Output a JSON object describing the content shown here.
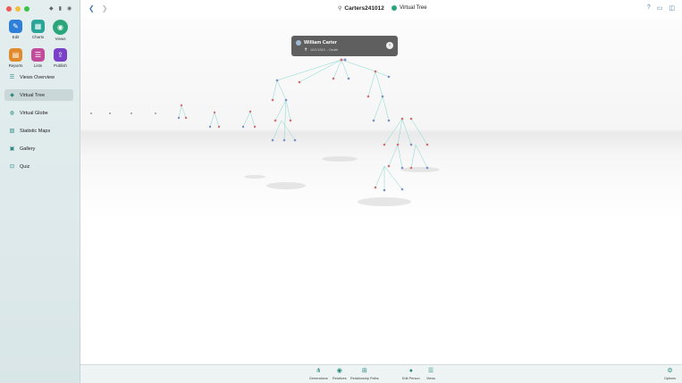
{
  "window": {
    "title": "Carters241012",
    "view_name": "Virtual Tree"
  },
  "sidebar": {
    "apps": [
      {
        "label": "Edit",
        "icon": "pencil-icon",
        "color": "#2f7fd8"
      },
      {
        "label": "Charts",
        "icon": "charts-icon",
        "color": "#2aa699"
      },
      {
        "label": "Views",
        "icon": "eye-icon",
        "color": "#2aa67a",
        "selected": true
      },
      {
        "label": "Reports",
        "icon": "reports-icon",
        "color": "#e08a2c"
      },
      {
        "label": "Lists",
        "icon": "list-icon",
        "color": "#c24c9c"
      },
      {
        "label": "Publish",
        "icon": "publish-icon",
        "color": "#7a40c8"
      }
    ],
    "nav": [
      {
        "label": "Views Overview",
        "icon": "views-overview-icon"
      },
      {
        "label": "Virtual Tree",
        "icon": "virtual-tree-icon",
        "active": true
      },
      {
        "label": "Virtual Globe",
        "icon": "globe-icon"
      },
      {
        "label": "Statistic Maps",
        "icon": "statistic-maps-icon"
      },
      {
        "label": "Gallery",
        "icon": "gallery-icon"
      },
      {
        "label": "Quiz",
        "icon": "quiz-icon"
      }
    ]
  },
  "popup": {
    "name": "William Carter",
    "details": "10/2/1810 – Death"
  },
  "bottom_toolbar": {
    "generations": "Generations",
    "relatives": "Relatives",
    "relationship_paths": "Relationship Paths",
    "edit_person": "Edit Person",
    "views": "Views",
    "options": "Options"
  },
  "colors": {
    "accent": "#2aa67a",
    "link": "#4a7fb0",
    "tree_line": "#7fd6cf"
  }
}
